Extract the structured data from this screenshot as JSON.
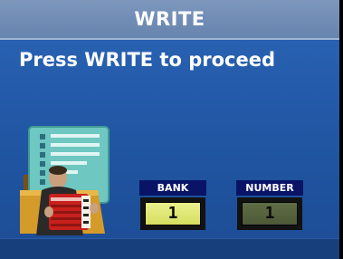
{
  "header": {
    "title": "WRITE"
  },
  "message": {
    "text": "Press WRITE to proceed"
  },
  "params": {
    "bank": {
      "label": "BANK",
      "value": "1"
    },
    "number": {
      "label": "NUMBER",
      "value": "1"
    }
  },
  "icons": {
    "photo": "accordion-player-folder-icon"
  },
  "colors": {
    "background": "#2258a6",
    "title_bar": "#6f8cb5",
    "label_bg": "#0a1466",
    "bank_field": "#e0e777",
    "number_field": "#56633e"
  }
}
